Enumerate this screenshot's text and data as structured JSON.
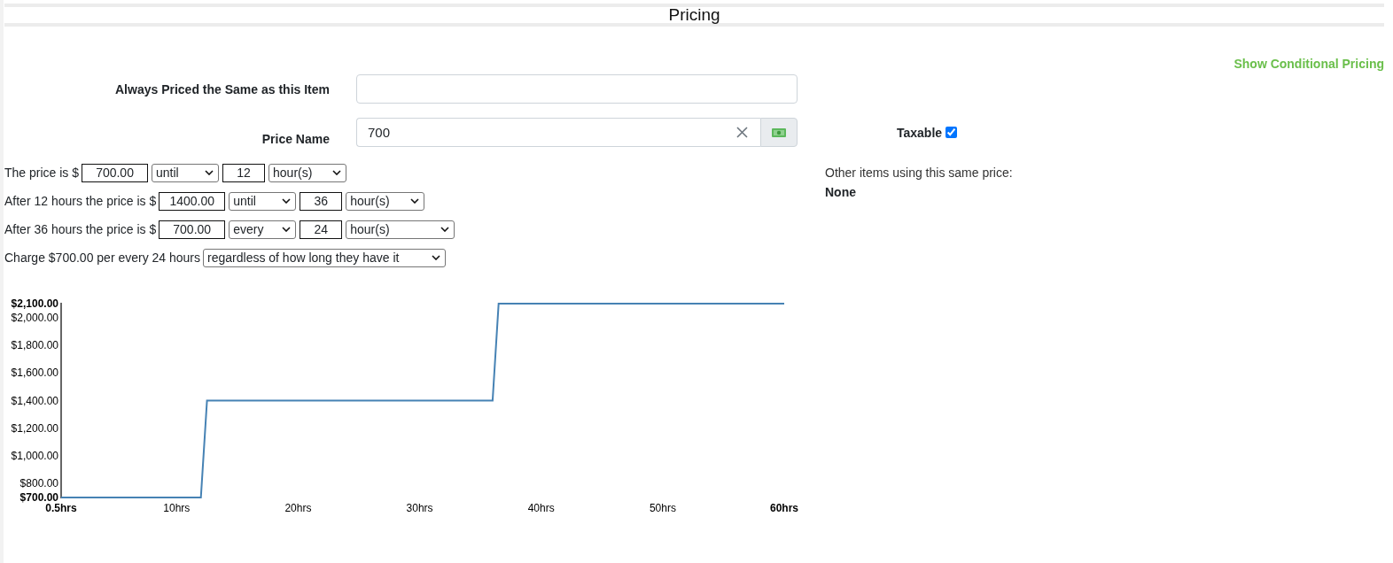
{
  "header": {
    "title": "Pricing"
  },
  "conditional_link": "Show Conditional Pricing",
  "fields": [
    {
      "kind": "text",
      "label": "Always Priced the Same as this Item"
    },
    {
      "kind": "price-name",
      "label": "Price Name",
      "value": "700"
    }
  ],
  "taxable": {
    "label": "Taxable",
    "checked": true
  },
  "other_items": {
    "label": "Other items using this same price:",
    "value": "None"
  },
  "rules": [
    {
      "text": "The price is $",
      "price": "700.00",
      "mode": "until",
      "amount": "12",
      "unit": "hour(s)"
    },
    {
      "text": "After 12 hours the price is $",
      "price": "1400.00",
      "mode": "until",
      "amount": "36",
      "unit": "hour(s)"
    },
    {
      "text": "After 36 hours the price is $",
      "price": "700.00",
      "mode": "every",
      "amount": "24",
      "unit": "hour(s)"
    }
  ],
  "charge": {
    "text": "Charge $700.00 per every 24 hours",
    "option": "regardless of how long they have it"
  },
  "chart": {
    "chart_data": {
      "type": "line",
      "x": [
        0.5,
        12,
        12.5,
        36,
        36.5,
        60
      ],
      "values": [
        700,
        700,
        1400,
        1400,
        2100,
        2100
      ],
      "xlim": [
        0.5,
        60
      ],
      "ylim": [
        700,
        2100
      ],
      "xticks": [
        {
          "value": 0.5,
          "label": "0.5hrs"
        },
        {
          "value": 10,
          "label": "10hrs"
        },
        {
          "value": 20,
          "label": "20hrs"
        },
        {
          "value": 30,
          "label": "30hrs"
        },
        {
          "value": 40,
          "label": "40hrs"
        },
        {
          "value": 50,
          "label": "50hrs"
        },
        {
          "value": 60,
          "label": "60hrs"
        }
      ],
      "yticks": [
        {
          "value": 700,
          "label": "$700.00"
        },
        {
          "value": 800,
          "label": "$800.00"
        },
        {
          "value": 1000,
          "label": "$1,000.00"
        },
        {
          "value": 1200,
          "label": "$1,200.00"
        },
        {
          "value": 1400,
          "label": "$1,400.00"
        },
        {
          "value": 1600,
          "label": "$1,600.00"
        },
        {
          "value": 1800,
          "label": "$1,800.00"
        },
        {
          "value": 2000,
          "label": "$2,000.00"
        },
        {
          "value": 2100,
          "label": "$2,100.00"
        }
      ]
    }
  }
}
